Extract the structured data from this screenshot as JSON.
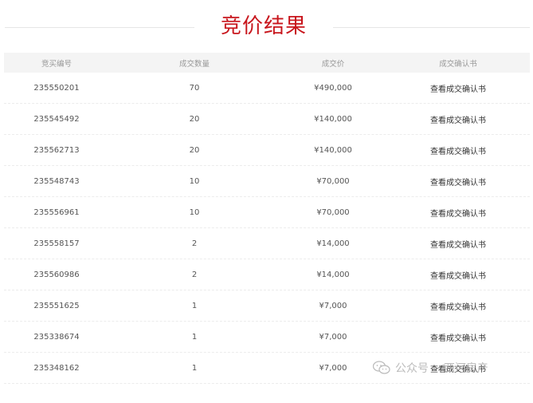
{
  "section": {
    "title": "竞价结果"
  },
  "table": {
    "headers": {
      "id": "竞买编号",
      "quantity": "成交数量",
      "price": "成交价",
      "confirmation": "成交确认书"
    },
    "rows": [
      {
        "id": "235550201",
        "quantity": "70",
        "price": "¥490,000",
        "link": "查看成交确认书"
      },
      {
        "id": "235545492",
        "quantity": "20",
        "price": "¥140,000",
        "link": "查看成交确认书"
      },
      {
        "id": "235562713",
        "quantity": "20",
        "price": "¥140,000",
        "link": "查看成交确认书"
      },
      {
        "id": "235548743",
        "quantity": "10",
        "price": "¥70,000",
        "link": "查看成交确认书"
      },
      {
        "id": "235556961",
        "quantity": "10",
        "price": "¥70,000",
        "link": "查看成交确认书"
      },
      {
        "id": "235558157",
        "quantity": "2",
        "price": "¥14,000",
        "link": "查看成交确认书"
      },
      {
        "id": "235560986",
        "quantity": "2",
        "price": "¥14,000",
        "link": "查看成交确认书"
      },
      {
        "id": "235551625",
        "quantity": "1",
        "price": "¥7,000",
        "link": "查看成交确认书"
      },
      {
        "id": "235338674",
        "quantity": "1",
        "price": "¥7,000",
        "link": "查看成交确认书"
      },
      {
        "id": "235348162",
        "quantity": "1",
        "price": "¥7,000",
        "link": "查看成交确认书"
      }
    ]
  },
  "watermark": {
    "icon": "wechat-icon",
    "label": "公众号",
    "brand": "· 西河房产"
  },
  "colors": {
    "title": "#c8161d",
    "header_bg": "#f4f4f4"
  }
}
